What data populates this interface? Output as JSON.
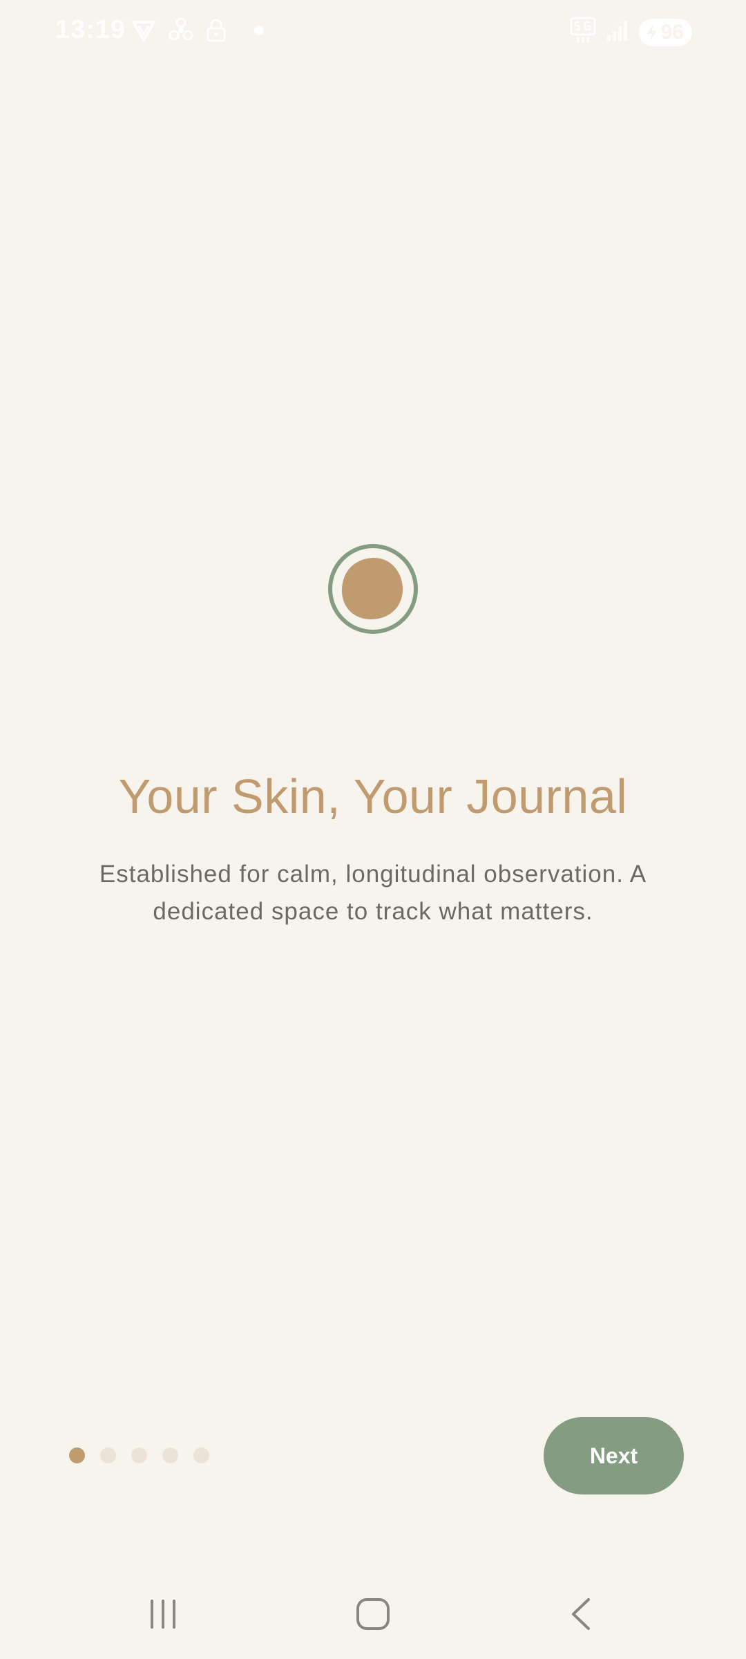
{
  "status_bar": {
    "time": "13:19",
    "battery": "96",
    "left_icons": [
      "vpn-icon",
      "fan-icon",
      "lock-icon",
      "dot-icon"
    ],
    "right_icons": [
      "network-5g-icon",
      "signal-icon",
      "battery-icon"
    ]
  },
  "logo": {
    "icon": "circle-logo-icon",
    "ring_color": "#849d82",
    "fill_color": "#bf9b6f"
  },
  "onboarding": {
    "title": "Your Skin, Your Journal",
    "subtitle": "Established for calm, longitudinal observation. A dedicated space to track what matters.",
    "page_count": 5,
    "current_page": 1
  },
  "actions": {
    "next_label": "Next"
  },
  "colors": {
    "background": "#f7f4ee",
    "accent": "#bf9b6f",
    "button": "#849d82",
    "text": "#6d6862",
    "dot_inactive": "#ece3d8"
  },
  "nav_bar": {
    "items": [
      "recents-icon",
      "home-icon",
      "back-icon"
    ]
  }
}
